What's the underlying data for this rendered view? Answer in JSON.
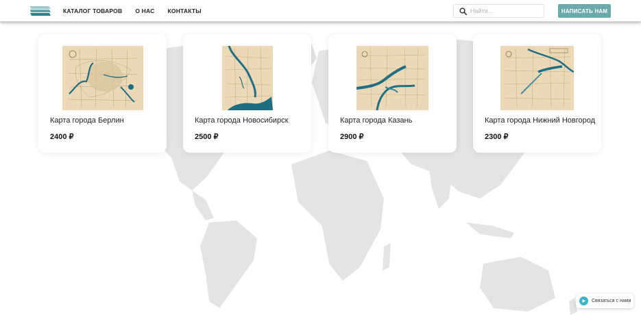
{
  "header": {
    "nav": [
      "КАТАЛОГ ТОВАРОВ",
      "О НАС",
      "КОНТАКТЫ"
    ],
    "search_placeholder": "Найти...",
    "cta_label": "НАПИСАТЬ НАМ"
  },
  "products": [
    {
      "title": "Карта города Берлин",
      "price": "2400 ₽"
    },
    {
      "title": "Карта города Новосибирск",
      "price": "2500 ₽"
    },
    {
      "title": "Карта города Казань",
      "price": "2900 ₽"
    },
    {
      "title": "Карта города Нижний Новгород",
      "price": "2300 ₽"
    }
  ],
  "contact_widget": {
    "label": "Связаться с нами"
  },
  "colors": {
    "accent": "#6aa9ac",
    "river": "#1f6f84",
    "map_paper": "#ead8b6",
    "world_map": "#e3e3e3"
  }
}
